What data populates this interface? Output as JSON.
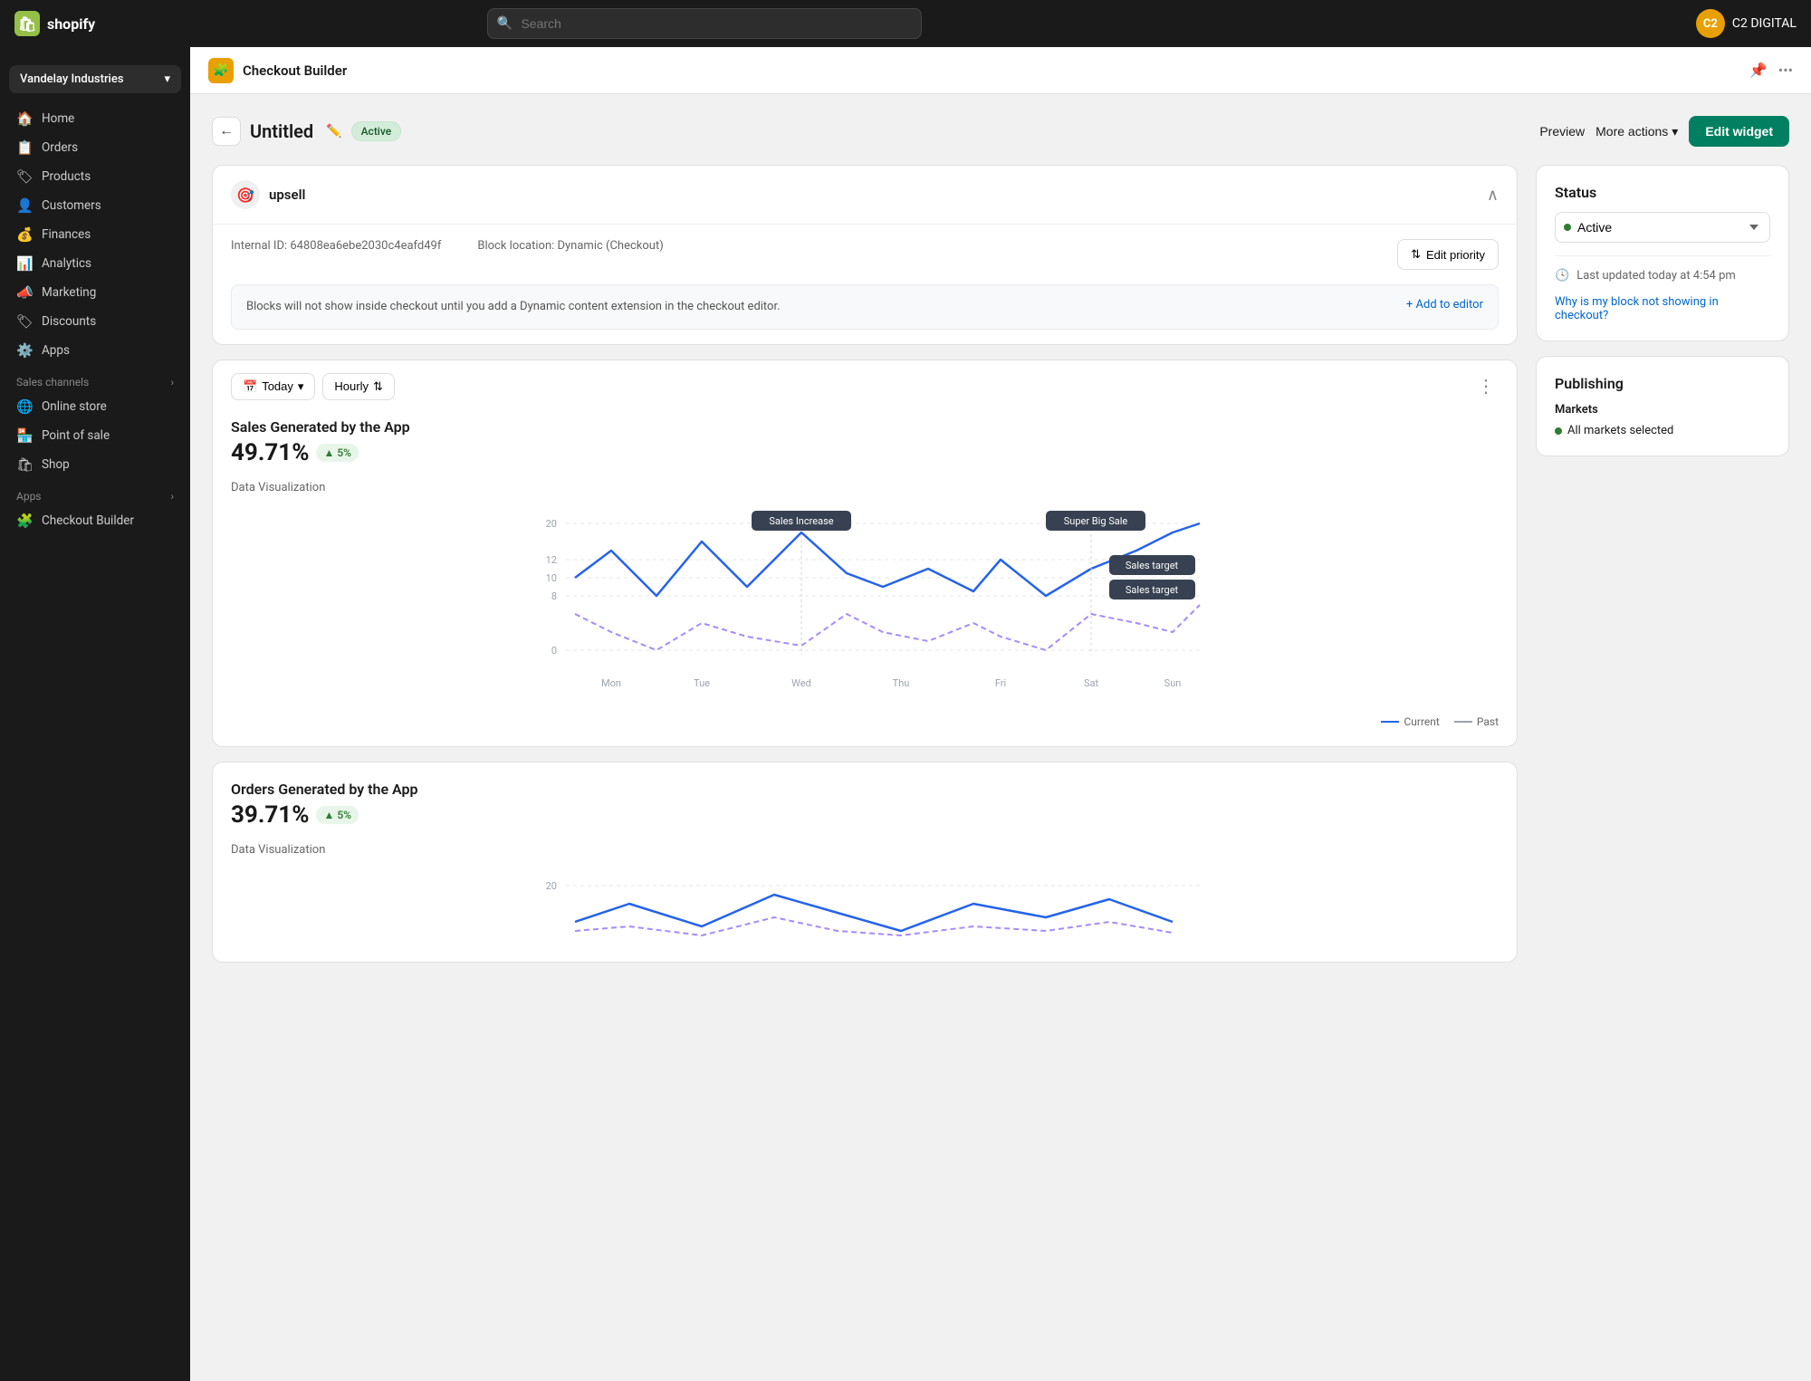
{
  "topnav": {
    "logo_text": "shopify",
    "search_placeholder": "Search",
    "user_initials": "C2",
    "user_name": "C2 DIGITAL"
  },
  "sidebar": {
    "store_name": "Vandelay Industries",
    "nav_items": [
      {
        "id": "home",
        "label": "Home",
        "icon": "🏠"
      },
      {
        "id": "orders",
        "label": "Orders",
        "icon": "📋"
      },
      {
        "id": "products",
        "label": "Products",
        "icon": "🏷"
      },
      {
        "id": "customers",
        "label": "Customers",
        "icon": "👤"
      },
      {
        "id": "finances",
        "label": "Finances",
        "icon": "💰"
      },
      {
        "id": "analytics",
        "label": "Analytics",
        "icon": "📊"
      },
      {
        "id": "marketing",
        "label": "Marketing",
        "icon": "📣"
      },
      {
        "id": "discounts",
        "label": "Discounts",
        "icon": "🏷"
      },
      {
        "id": "apps",
        "label": "Apps",
        "icon": "⚙️"
      }
    ],
    "sales_channels_label": "Sales channels",
    "sales_channels": [
      {
        "id": "online-store",
        "label": "Online store",
        "icon": "🌐"
      },
      {
        "id": "point-of-sale",
        "label": "Point of sale",
        "icon": "🏪"
      },
      {
        "id": "shop",
        "label": "Shop",
        "icon": "🛍"
      }
    ],
    "apps_section_label": "Apps",
    "apps": [
      {
        "id": "checkout-builder",
        "label": "Checkout Builder",
        "icon": "🧩"
      }
    ]
  },
  "app_header": {
    "title": "Checkout Builder",
    "app_icon": "🧩"
  },
  "widget": {
    "back_label": "←",
    "name": "Untitled",
    "status_badge": "Active",
    "preview_label": "Preview",
    "more_actions_label": "More actions",
    "edit_widget_label": "Edit widget"
  },
  "upsell_card": {
    "title": "upsell",
    "internal_id_label": "Internal ID:",
    "internal_id_value": "64808ea6ebe2030c4eafd49f",
    "block_location_label": "Block location:",
    "block_location_value": "Dynamic (Checkout)",
    "edit_priority_label": "Edit priority",
    "notice_text": "Blocks will not show inside checkout until you add a Dynamic content extension in the checkout editor.",
    "add_to_editor_label": "+ Add to editor"
  },
  "chart_filters": {
    "today_label": "Today",
    "hourly_label": "Hourly"
  },
  "sales_chart": {
    "title": "Sales Generated by the App",
    "percent": "49.71%",
    "trend": "↑ 5%",
    "section_label": "Data Visualization",
    "y_labels": [
      "20",
      "12",
      "10",
      "8",
      "0"
    ],
    "x_labels": [
      "Mon",
      "Tue",
      "Wed",
      "Thu",
      "Fri",
      "Sat",
      "Sun"
    ],
    "tooltip1": "Sales Increase",
    "tooltip2": "Super Big Sale",
    "tooltip3": "Sales target",
    "tooltip4": "Sales target",
    "legend_current": "Current",
    "legend_past": "Past"
  },
  "orders_chart": {
    "title": "Orders Generated by the App",
    "percent": "39.71%",
    "trend": "↑ 5%",
    "section_label": "Data Visualization",
    "y_labels": [
      "20"
    ]
  },
  "status_panel": {
    "title": "Status",
    "status_value": "Active",
    "last_updated_label": "Last updated today at 4:54 pm",
    "help_link": "Why is my block not showing in checkout?"
  },
  "publishing_panel": {
    "title": "Publishing",
    "markets_label": "Markets",
    "markets_value": "All markets selected"
  }
}
